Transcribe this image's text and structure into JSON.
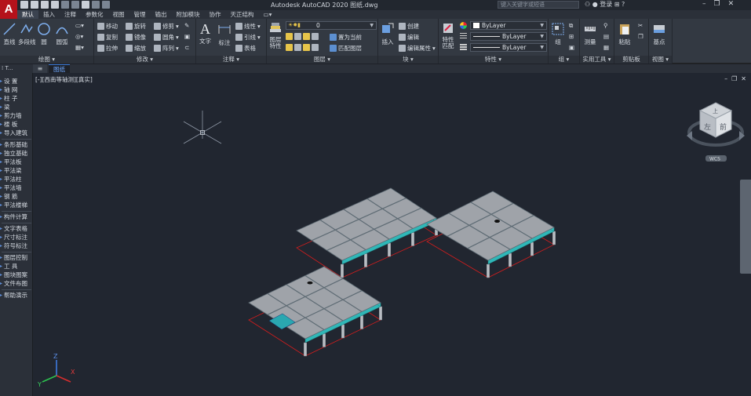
{
  "titlebar": {
    "logo": "A",
    "title": "Autodesk AutoCAD 2020    图纸.dwg",
    "search_placeholder": "键入关键字或短语",
    "login": "登录"
  },
  "tabs": [
    "默认",
    "插入",
    "注释",
    "参数化",
    "视图",
    "管理",
    "输出",
    "附加模块",
    "协作",
    "天正结构"
  ],
  "ribbon": {
    "draw": {
      "title": "绘图",
      "line": "直线",
      "polyline": "多段线",
      "circle": "圆",
      "arc": "圆弧"
    },
    "modify": {
      "title": "修改",
      "move": "移动",
      "rotate": "旋转",
      "trim": "修剪",
      "copy": "复制",
      "mirror": "镜像",
      "fillet": "圆角",
      "stretch": "拉伸",
      "scale": "缩放",
      "array": "阵列"
    },
    "annotation": {
      "title": "注释",
      "text": "文字",
      "dimension": "标注",
      "linear": "线性",
      "leader": "引线",
      "table": "表格"
    },
    "layers": {
      "title": "图层",
      "properties": "图层\n特性",
      "current_layer": "0",
      "make_current": "置为当前",
      "match_layer": "匹配图层"
    },
    "block": {
      "title": "块",
      "insert": "插入",
      "create": "创建",
      "edit": "编辑",
      "edit_attr": "编辑属性"
    },
    "properties": {
      "title": "特性",
      "match": "特性\n匹配",
      "color": "ByLayer",
      "linetype": "ByLayer",
      "lineweight": "ByLayer"
    },
    "groups": {
      "title": "组",
      "group": "组"
    },
    "utilities": {
      "title": "实用工具",
      "measure": "测量"
    },
    "clipboard": {
      "title": "剪贴板",
      "paste": "粘贴"
    },
    "view": {
      "title": "视图",
      "base": "基点"
    }
  },
  "filetabs": {
    "menu": "T...",
    "file": "图纸"
  },
  "palette": {
    "items": [
      "设  置",
      "轴  网",
      "柱  子",
      "梁",
      "剪力墙",
      "楼  板",
      "导入建筑",
      "条形基础",
      "独立基础",
      "平法板",
      "平法梁",
      "平法柱",
      "平法墙",
      "钢  筋",
      "平法楼梯",
      "构件计算",
      "文字表格",
      "尺寸标注",
      "符号标注",
      "图层控制",
      "工  具",
      "图块图案",
      "文件布图",
      "帮助演示"
    ]
  },
  "viewport": {
    "label": "[-][西南等轴测][真实]",
    "viewcube_top": "上",
    "viewcube_left": "左",
    "viewcube_front": "前",
    "wcs": "WCS",
    "ucs_x": "X",
    "ucs_y": "Y",
    "ucs_z": "Z"
  },
  "colors": {
    "slab": "#9fa3a9",
    "slab_edge": "#5e6b74",
    "beam": "#2fb7b7",
    "column": "#b9bdc3",
    "red_axis": "#d21d1d",
    "background": "#212630"
  }
}
